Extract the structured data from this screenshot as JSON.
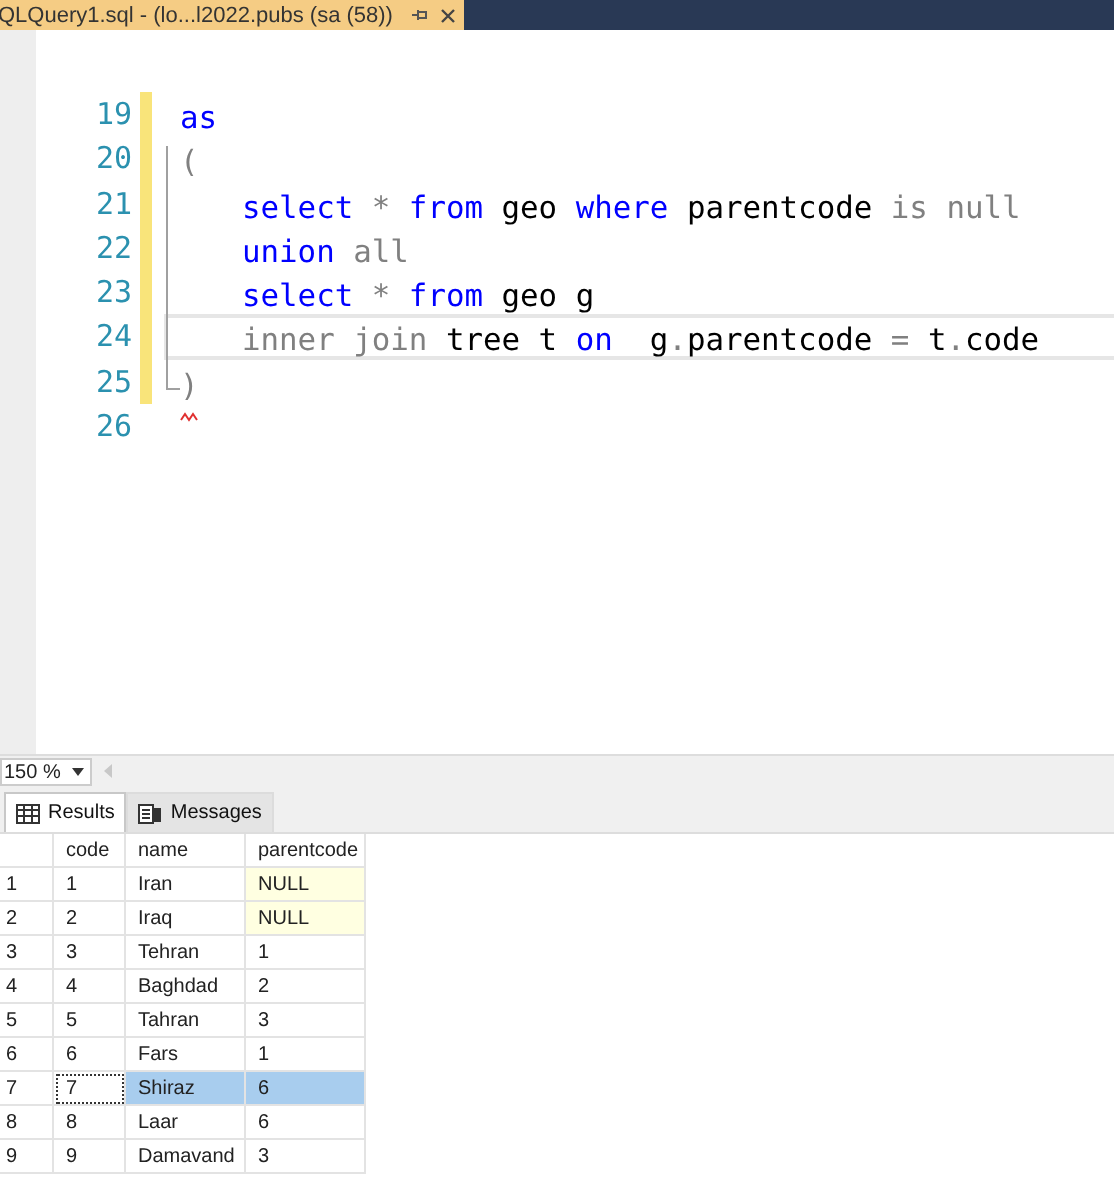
{
  "document_tab": {
    "title": "QLQuery1.sql - (lo...l2022.pubs (sa (58))"
  },
  "editor": {
    "lines": [
      {
        "number": "19",
        "current": false,
        "indent": false,
        "tokens": [
          {
            "text": "as",
            "kind": "keyword"
          }
        ]
      },
      {
        "number": "20",
        "current": false,
        "indent": false,
        "tokens": [
          {
            "text": "(",
            "kind": "gray"
          }
        ]
      },
      {
        "number": "21",
        "current": false,
        "indent": true,
        "tokens": [
          {
            "text": "select",
            "kind": "keyword"
          },
          {
            "text": " * ",
            "kind": "gray"
          },
          {
            "text": "from",
            "kind": "keyword"
          },
          {
            "text": " geo ",
            "kind": "plain"
          },
          {
            "text": "where",
            "kind": "keyword"
          },
          {
            "text": " parentcode ",
            "kind": "plain"
          },
          {
            "text": "is null",
            "kind": "gray"
          }
        ]
      },
      {
        "number": "22",
        "current": false,
        "indent": true,
        "tokens": [
          {
            "text": "union",
            "kind": "keyword"
          },
          {
            "text": " all",
            "kind": "gray"
          }
        ]
      },
      {
        "number": "23",
        "current": false,
        "indent": true,
        "tokens": [
          {
            "text": "select",
            "kind": "keyword"
          },
          {
            "text": " * ",
            "kind": "gray"
          },
          {
            "text": "from",
            "kind": "keyword"
          },
          {
            "text": " geo g",
            "kind": "plain"
          }
        ]
      },
      {
        "number": "24",
        "current": true,
        "indent": true,
        "tokens": [
          {
            "text": "inner join",
            "kind": "gray"
          },
          {
            "text": " tree t ",
            "kind": "plain"
          },
          {
            "text": "on",
            "kind": "keyword"
          },
          {
            "text": "  g",
            "kind": "plain"
          },
          {
            "text": ".",
            "kind": "gray"
          },
          {
            "text": "parentcode ",
            "kind": "plain"
          },
          {
            "text": "=",
            "kind": "gray"
          },
          {
            "text": " t",
            "kind": "plain"
          },
          {
            "text": ".",
            "kind": "gray"
          },
          {
            "text": "code",
            "kind": "plain"
          }
        ]
      },
      {
        "number": "25",
        "current": false,
        "indent": false,
        "tokens": [
          {
            "text": ")",
            "kind": "gray"
          }
        ]
      },
      {
        "number": "26",
        "current": false,
        "squiggle": true
      }
    ]
  },
  "zoom": {
    "value": "150 %"
  },
  "result_tabs": [
    {
      "label": "Results",
      "selected": true
    },
    {
      "label": "Messages",
      "selected": false
    }
  ],
  "grid": {
    "columns": [
      "code",
      "name",
      "parentcode"
    ],
    "rows": [
      {
        "number": "1",
        "selected": false,
        "cells": [
          {
            "text": "1",
            "kind": "value"
          },
          {
            "text": "Iran",
            "kind": "value"
          },
          {
            "text": "NULL",
            "kind": "null"
          }
        ]
      },
      {
        "number": "2",
        "selected": false,
        "cells": [
          {
            "text": "2",
            "kind": "value"
          },
          {
            "text": "Iraq",
            "kind": "value"
          },
          {
            "text": "NULL",
            "kind": "null"
          }
        ]
      },
      {
        "number": "3",
        "selected": false,
        "cells": [
          {
            "text": "3",
            "kind": "value"
          },
          {
            "text": "Tehran",
            "kind": "value"
          },
          {
            "text": "1",
            "kind": "value"
          }
        ]
      },
      {
        "number": "4",
        "selected": false,
        "cells": [
          {
            "text": "4",
            "kind": "value"
          },
          {
            "text": "Baghdad",
            "kind": "value"
          },
          {
            "text": "2",
            "kind": "value"
          }
        ]
      },
      {
        "number": "5",
        "selected": false,
        "cells": [
          {
            "text": "5",
            "kind": "value"
          },
          {
            "text": "Tahran",
            "kind": "value"
          },
          {
            "text": "3",
            "kind": "value"
          }
        ]
      },
      {
        "number": "6",
        "selected": false,
        "cells": [
          {
            "text": "6",
            "kind": "value"
          },
          {
            "text": "Fars",
            "kind": "value"
          },
          {
            "text": "1",
            "kind": "value"
          }
        ]
      },
      {
        "number": "7",
        "selected": true,
        "cells": [
          {
            "text": "7",
            "kind": "focus"
          },
          {
            "text": "Shiraz",
            "kind": "value"
          },
          {
            "text": "6",
            "kind": "value"
          }
        ]
      },
      {
        "number": "8",
        "selected": false,
        "cells": [
          {
            "text": "8",
            "kind": "value"
          },
          {
            "text": "Laar",
            "kind": "value"
          },
          {
            "text": "6",
            "kind": "value"
          }
        ]
      },
      {
        "number": "9",
        "selected": false,
        "cells": [
          {
            "text": "9",
            "kind": "value"
          },
          {
            "text": "Damavand",
            "kind": "value"
          },
          {
            "text": "3",
            "kind": "value"
          }
        ]
      }
    ]
  }
}
